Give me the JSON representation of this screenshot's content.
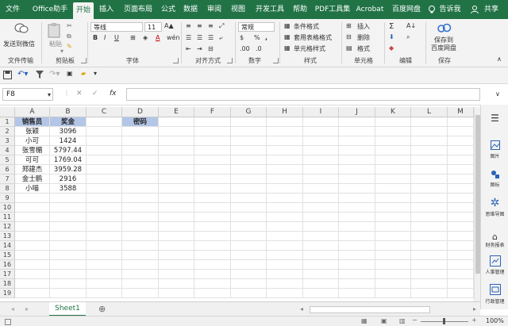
{
  "tabs": [
    "文件",
    "Office助手",
    "开始",
    "插入",
    "页面布局",
    "公式",
    "数据",
    "审阅",
    "视图",
    "开发工具",
    "帮助",
    "PDF工具集",
    "Acrobat",
    "百度网盘",
    "告诉我",
    "共享"
  ],
  "ribbon": {
    "send_wechat": "发送到微信",
    "paste": "粘贴",
    "font_name": "等线",
    "font_size": "11",
    "number_format": "常规",
    "cond_format": "条件格式",
    "table_format": "套用表格格式",
    "cell_style": "单元格样式",
    "insert": "插入",
    "delete": "删除",
    "format": "格式",
    "save_baidu_1": "保存到",
    "save_baidu_2": "百度网盘",
    "groups": [
      "文件传输",
      "剪贴板",
      "字体",
      "对齐方式",
      "数字",
      "样式",
      "单元格",
      "编辑",
      "保存"
    ]
  },
  "formula": {
    "namebox": "F8",
    "fx": "fx",
    "value": ""
  },
  "columns": [
    "A",
    "B",
    "C",
    "D",
    "E",
    "F",
    "G",
    "H",
    "I",
    "J",
    "K",
    "L",
    "M"
  ],
  "rows": [
    "1",
    "2",
    "3",
    "4",
    "5",
    "6",
    "7",
    "8",
    "9",
    "10",
    "11",
    "12",
    "13",
    "14",
    "15",
    "16",
    "17",
    "18",
    "19"
  ],
  "table": {
    "header": [
      "销售员",
      "奖金"
    ],
    "data": [
      [
        "张颖",
        "3096"
      ],
      [
        "小可",
        "1424"
      ],
      [
        "张雪楣",
        "5797.44"
      ],
      [
        "可可",
        "1769.04"
      ],
      [
        "郑建杰",
        "3959.28"
      ],
      [
        "金士鹏",
        "2916"
      ],
      [
        "小喵",
        "3588"
      ]
    ],
    "d1": "密码"
  },
  "right_pane": [
    "图片",
    "图标",
    "思维导图",
    "财务报表",
    "人事管理",
    "行政管理"
  ],
  "sheet_tab": "Sheet1",
  "zoom": "100%",
  "colors": {
    "excel_green": "#217346",
    "header_fill": "#b4c6e7"
  }
}
